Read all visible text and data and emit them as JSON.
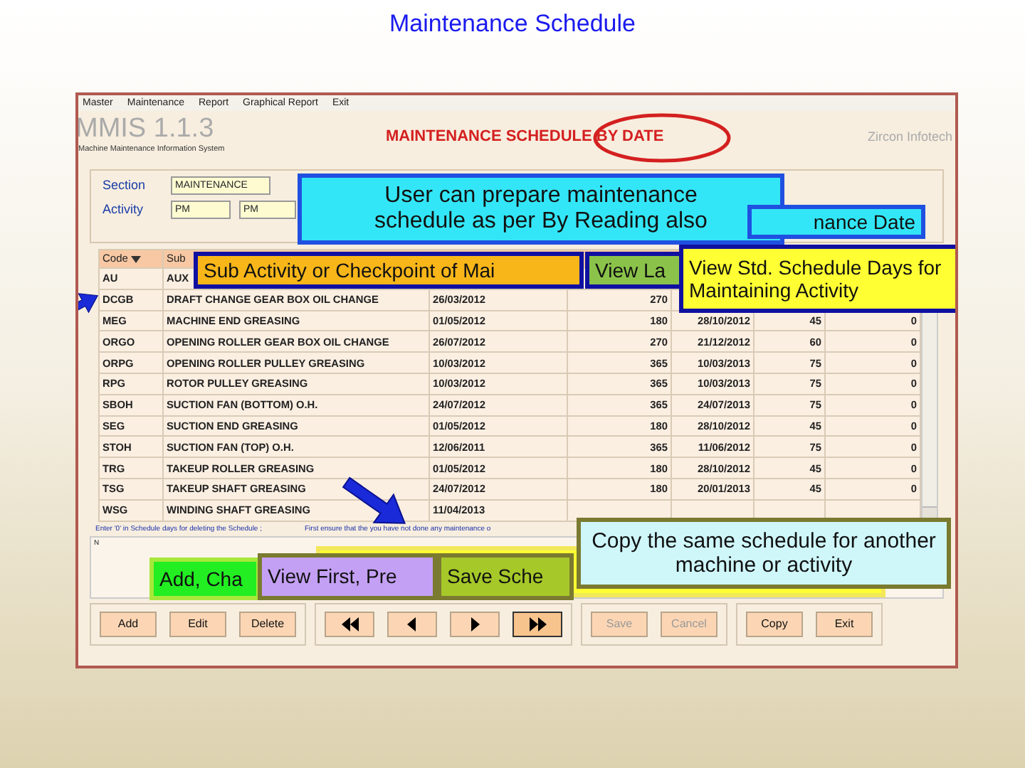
{
  "slide_title": "Maintenance Schedule",
  "menu": [
    "Master",
    "Maintenance",
    "Report",
    "Graphical Report",
    "Exit"
  ],
  "header": {
    "app_name": "MMIS 1.1.3",
    "app_subtitle": "Machine Maintenance Information System",
    "screen_title": "MAINTENANCE SCHEDULE BY DATE",
    "company": "Zircon Infotech"
  },
  "form": {
    "section_label": "Section",
    "section_value": "MAINTENANCE",
    "activity_label": "Activity",
    "activity_value": "PM",
    "activity_name": "PM"
  },
  "table": {
    "columns": [
      "Code",
      "Sub"
    ],
    "rows": [
      [
        "AU",
        "AUX",
        "",
        "",
        "",
        "",
        ""
      ],
      [
        "DCGB",
        "DRAFT CHANGE GEAR BOX OIL CHANGE",
        "26/03/2012",
        "270",
        "",
        "",
        ""
      ],
      [
        "MEG",
        "MACHINE END GREASING",
        "01/05/2012",
        "180",
        "28/10/2012",
        "45",
        "0"
      ],
      [
        "ORGO",
        "OPENING ROLLER GEAR BOX OIL CHANGE",
        "26/07/2012",
        "270",
        "21/12/2012",
        "60",
        "0"
      ],
      [
        "ORPG",
        "OPENING ROLLER PULLEY GREASING",
        "10/03/2012",
        "365",
        "10/03/2013",
        "75",
        "0"
      ],
      [
        "RPG",
        "ROTOR PULLEY GREASING",
        "10/03/2012",
        "365",
        "10/03/2013",
        "75",
        "0"
      ],
      [
        "SBOH",
        "SUCTION FAN (BOTTOM) O.H.",
        "24/07/2012",
        "365",
        "24/07/2013",
        "75",
        "0"
      ],
      [
        "SEG",
        "SUCTION END GREASING",
        "01/05/2012",
        "180",
        "28/10/2012",
        "45",
        "0"
      ],
      [
        "STOH",
        "SUCTION FAN (TOP) O.H.",
        "12/06/2011",
        "365",
        "11/06/2012",
        "75",
        "0"
      ],
      [
        "TRG",
        "TAKEUP ROLLER GREASING",
        "01/05/2012",
        "180",
        "28/10/2012",
        "45",
        "0"
      ],
      [
        "TSG",
        "TAKEUP SHAFT GREASING",
        "24/07/2012",
        "180",
        "20/01/2013",
        "45",
        "0"
      ],
      [
        "WSG",
        "WINDING SHAFT GREASING",
        "11/04/2013",
        "",
        "",
        "",
        ""
      ]
    ]
  },
  "notes": [
    "Enter '0' in Schedule days for deleting the Schedule ;",
    "First ensure that the you have not done any maintenance o"
  ],
  "memo": "N",
  "button_groups": [
    [
      {
        "label": "Add",
        "disabled": false
      },
      {
        "label": "Edit",
        "disabled": false
      },
      {
        "label": "Delete",
        "disabled": false
      }
    ],
    [
      {
        "kind": "first",
        "selected": false
      },
      {
        "kind": "previous",
        "selected": false
      },
      {
        "kind": "next",
        "selected": false
      },
      {
        "kind": "last",
        "selected": true
      }
    ],
    [
      {
        "label": "Save",
        "disabled": true
      },
      {
        "label": "Cancel",
        "disabled": true
      }
    ],
    [
      {
        "label": "Copy",
        "disabled": false
      },
      {
        "label": "Exit",
        "disabled": false
      }
    ]
  ],
  "callouts": [
    {
      "text": "User can prepare maintenance schedule as per By Reading also",
      "color": "#33e6f7"
    },
    {
      "text": "nance Date",
      "color": "#33e6f7"
    },
    {
      "text": "Sub Activity or Checkpoint of Mai",
      "color": "#f8b619"
    },
    {
      "text": "View La",
      "color": "#8bc34a"
    },
    {
      "text": "View Std. Schedule Days for Maintaining Activity",
      "color": "#ffff33"
    },
    {
      "color": "#ffff33"
    },
    {
      "text": "Add, Cha",
      "color": "#22ee22"
    },
    {
      "text": "View First, Pre",
      "color": "#c4a0f5"
    },
    {
      "text": "Save Sche",
      "color": "#a6c829"
    },
    {
      "text": "Copy the same schedule for another machine or activity",
      "color": "#cff7fa"
    }
  ]
}
